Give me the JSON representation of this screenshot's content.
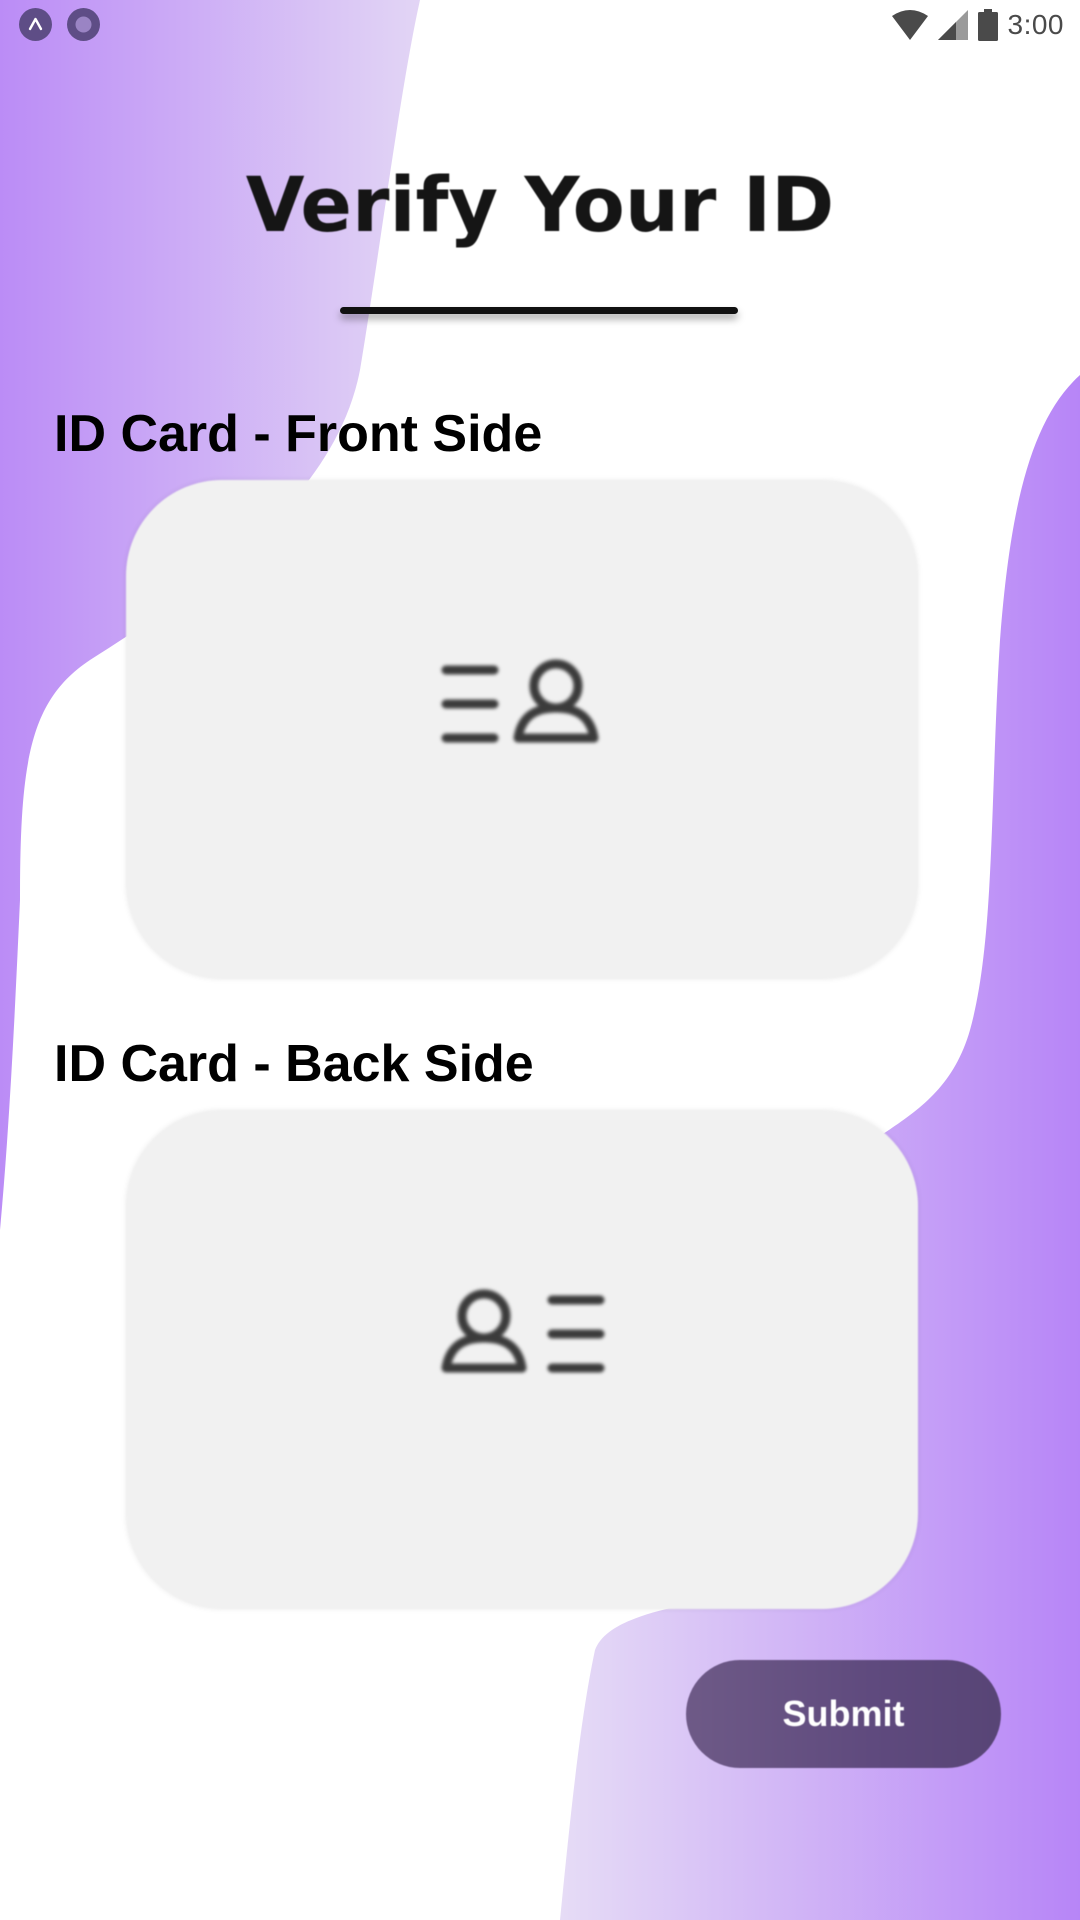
{
  "status_bar": {
    "time": "3:00",
    "left_icons": [
      "app-notification-icon",
      "circle-notification-icon"
    ],
    "right_icons": [
      "wifi-icon",
      "cellular-signal-icon",
      "battery-icon"
    ]
  },
  "header": {
    "title": "Verify Your ID"
  },
  "sections": [
    {
      "label": "ID Card - Front Side",
      "icon": "id-card-front-icon"
    },
    {
      "label": "ID Card - Back Side",
      "icon": "id-card-back-icon"
    }
  ],
  "actions": {
    "submit_label": "Submit"
  },
  "colors": {
    "background": "#ffffff",
    "wave_purple": "#bb8cf7",
    "wave_light": "#ddcdf4",
    "card": "#f1f1f1",
    "button": "#634f80",
    "button_text": "#ffffff"
  }
}
